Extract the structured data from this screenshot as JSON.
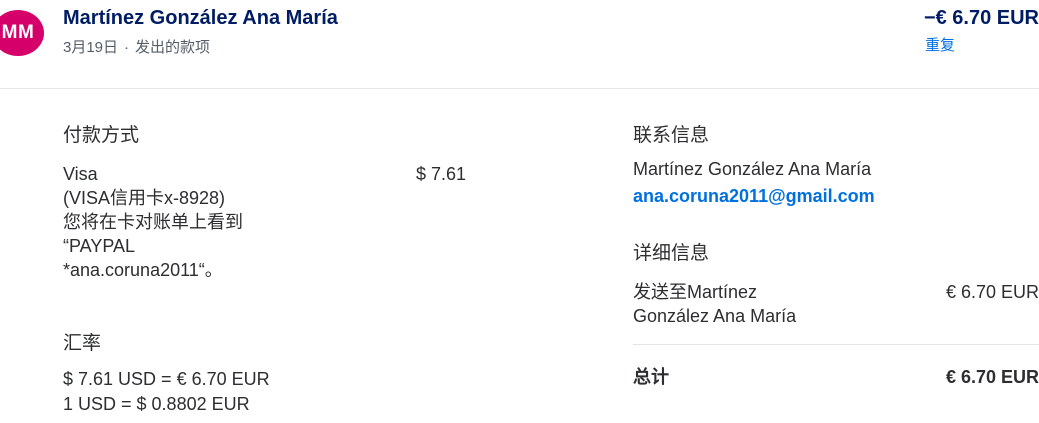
{
  "header": {
    "avatar_initials": "MM",
    "avatar_color": "#d6006a",
    "name": "Martínez González Ana María",
    "date": "3月19日",
    "separator": "·",
    "type": "发出的款项",
    "amount": "−€ 6.70 EUR",
    "repeat_label": "重复"
  },
  "payment": {
    "title": "付款方式",
    "method_lines": [
      "Visa",
      "(VISA信用卡x-8928)",
      "您将在卡对账单上看到",
      "“PAYPAL",
      "*ana.coruna2011“。"
    ],
    "amount": "$ 7.61"
  },
  "exchange": {
    "title": "汇率",
    "line1": "$ 7.61 USD = € 6.70 EUR",
    "line2": "1 USD = $ 0.8802 EUR"
  },
  "contact": {
    "title": "联系信息",
    "name": "Martínez González Ana María",
    "email": "ana.coruna2011@gmail.com"
  },
  "details": {
    "title": "详细信息",
    "sent_to_lines": [
      "发送至Martínez",
      "González Ana María"
    ],
    "sent_amount": "€ 6.70 EUR",
    "total_label": "总计",
    "total_amount": "€ 6.70 EUR"
  },
  "colors": {
    "accent": "#0070e0",
    "heading": "#001c64"
  }
}
